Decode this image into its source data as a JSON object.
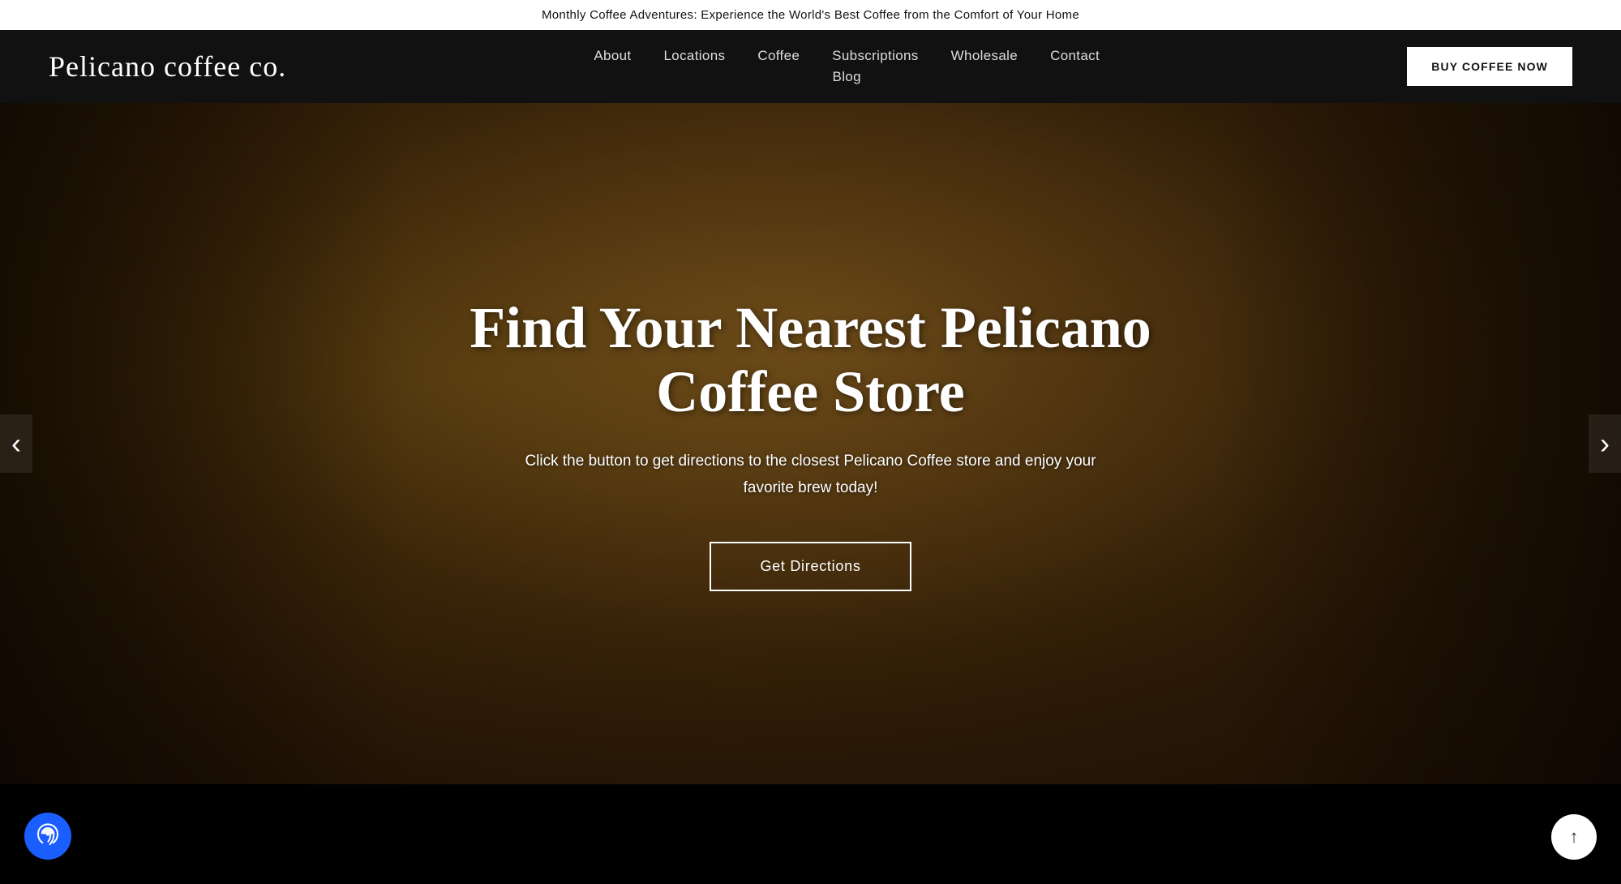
{
  "banner": {
    "text": "Monthly Coffee Adventures: Experience the World's Best Coffee from the Comfort of Your Home"
  },
  "header": {
    "logo": "Pelicano coffee co.",
    "nav": [
      {
        "label": "About",
        "href": "#"
      },
      {
        "label": "Locations",
        "href": "#"
      },
      {
        "label": "Coffee",
        "href": "#"
      },
      {
        "label": "Subscriptions",
        "href": "#"
      },
      {
        "label": "Wholesale",
        "href": "#"
      },
      {
        "label": "Contact",
        "href": "#"
      },
      {
        "label": "Blog",
        "href": "#"
      }
    ],
    "cta_label": "BUY COFFEE NOW"
  },
  "hero": {
    "title": "Find Your Nearest Pelicano Coffee Store",
    "subtitle": "Click the button to get directions to the closest Pelicano Coffee store and enjoy your favorite brew today!",
    "cta_label": "Get Directions",
    "prev_arrow": "‹",
    "next_arrow": "›"
  },
  "accessibility": {
    "fp_aria": "Accessibility options",
    "scroll_top_aria": "Scroll to top"
  }
}
